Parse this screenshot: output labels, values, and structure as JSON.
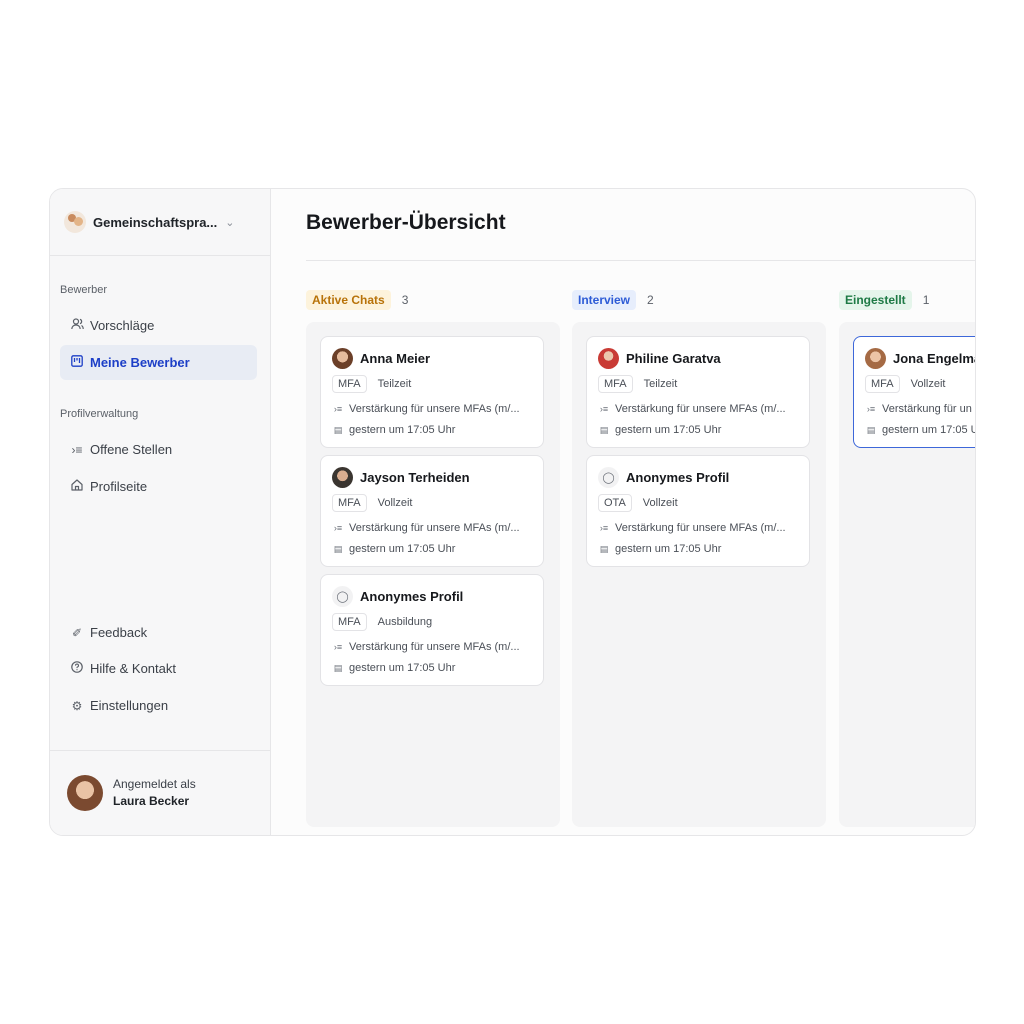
{
  "sidebar": {
    "org_name": "Gemeinschaftspra...",
    "sections": {
      "bewerber": "Bewerber",
      "profil": "Profilverwaltung"
    },
    "items": [
      {
        "label": "Vorschläge",
        "icon": "users-icon"
      },
      {
        "label": "Meine Bewerber",
        "icon": "kanban-icon",
        "active": true
      },
      {
        "label": "Offene Stellen",
        "icon": "list-icon"
      },
      {
        "label": "Profilseite",
        "icon": "home-icon"
      },
      {
        "label": "Feedback",
        "icon": "feedback-icon"
      },
      {
        "label": "Hilfe & Kontakt",
        "icon": "help-icon"
      },
      {
        "label": "Einstellungen",
        "icon": "gear-icon"
      }
    ],
    "user": {
      "prefix": "Angemeldet als",
      "name": "Laura Becker"
    }
  },
  "main": {
    "title": "Bewerber-Übersicht",
    "columns": [
      {
        "label": "Aktive Chats",
        "count": "3",
        "color": "#b8730a",
        "bg": "#fdf3dc",
        "cards": [
          {
            "name": "Anna Meier",
            "tags": [
              "MFA",
              "Teilzeit"
            ],
            "job": "Verstärkung für unsere MFAs (m/...",
            "time": "gestern um 17:05 Uhr"
          },
          {
            "name": "Jayson Terheiden",
            "tags": [
              "MFA",
              "Vollzeit"
            ],
            "job": "Verstärkung für unsere MFAs (m/...",
            "time": "gestern um 17:05 Uhr"
          },
          {
            "name": "Anonymes Profil",
            "tags": [
              "MFA",
              "Ausbildung"
            ],
            "job": "Verstärkung für unsere MFAs (m/...",
            "time": "gestern um 17:05 Uhr"
          }
        ]
      },
      {
        "label": "Interview",
        "count": "2",
        "color": "#2d5bd6",
        "bg": "#e7eefc",
        "cards": [
          {
            "name": "Philine Garatva",
            "tags": [
              "MFA",
              "Teilzeit"
            ],
            "job": "Verstärkung für unsere MFAs (m/...",
            "time": "gestern um 17:05 Uhr"
          },
          {
            "name": "Anonymes Profil",
            "tags": [
              "OTA",
              "Vollzeit"
            ],
            "job": "Verstärkung für unsere MFAs (m/...",
            "time": "gestern um 17:05 Uhr"
          }
        ]
      },
      {
        "label": "Eingestellt",
        "count": "1",
        "color": "#1e7a45",
        "bg": "#e5f5eb",
        "cards": [
          {
            "name": "Jona Engelmar",
            "tags": [
              "MFA",
              "Vollzeit"
            ],
            "job": "Verstärkung für un",
            "time": "gestern um 17:05 U"
          }
        ]
      }
    ]
  }
}
